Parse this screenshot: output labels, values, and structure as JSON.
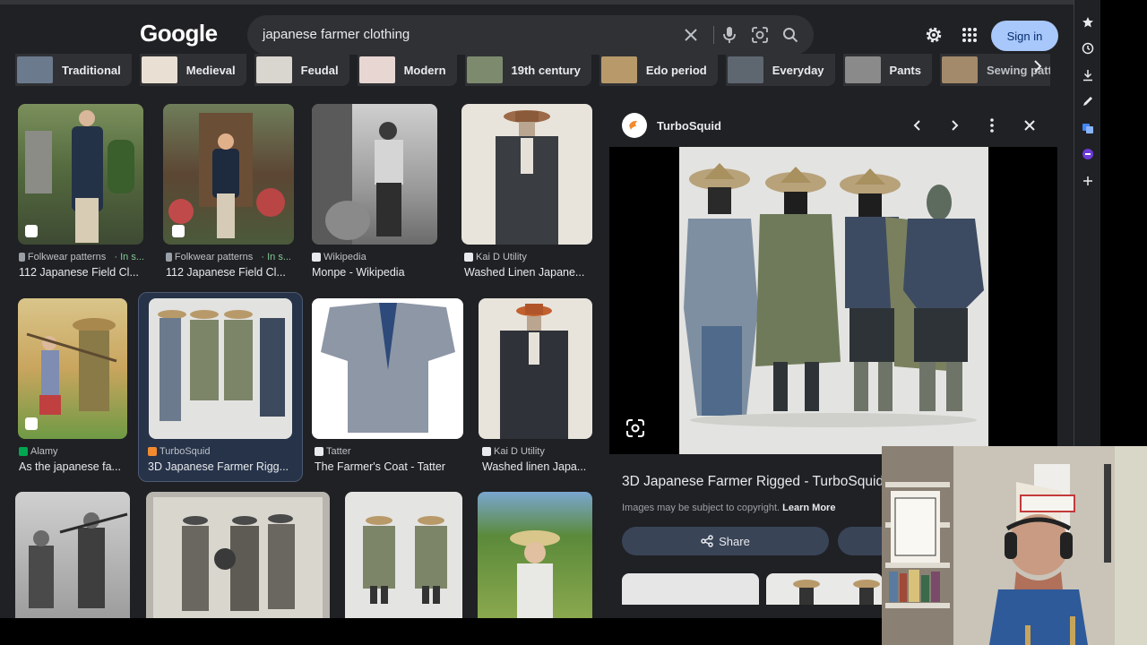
{
  "search": {
    "logo": "Google",
    "query": "japanese farmer clothing",
    "signin_label": "Sign in"
  },
  "chips": [
    {
      "label": "Traditional",
      "color": "#6b7a8c"
    },
    {
      "label": "Medieval",
      "color": "#c9b49a"
    },
    {
      "label": "Feudal",
      "color": "#a8a29b"
    },
    {
      "label": "Modern",
      "color": "#b14a3e"
    },
    {
      "label": "19th century",
      "color": "#7d8a6e"
    },
    {
      "label": "Edo period",
      "color": "#b89a6a"
    },
    {
      "label": "Everyday",
      "color": "#5e6670"
    },
    {
      "label": "Pants",
      "color": "#8a8a8a"
    },
    {
      "label": "Sewing patte",
      "color": "#a38a6a"
    }
  ],
  "results": [
    {
      "source": "Folkwear patterns",
      "source_extra": "· In s...",
      "title": "112 Japanese Field Cl...",
      "fav_color": "#9aa0a6"
    },
    {
      "source": "Folkwear patterns",
      "source_extra": "· In s...",
      "title": "112 Japanese Field Cl...",
      "fav_color": "#9aa0a6"
    },
    {
      "source": "Wikipedia",
      "source_extra": "",
      "title": "Monpe - Wikipedia",
      "fav_color": "#e8eaed"
    },
    {
      "source": "Kai D Utility",
      "source_extra": "",
      "title": "Washed Linen Japane...",
      "fav_color": "#e8eaed"
    },
    {
      "source": "Alamy",
      "source_extra": "",
      "title": "As the japanese fa...",
      "fav_color": "#00a651"
    },
    {
      "source": "TurboSquid",
      "source_extra": "",
      "title": "3D Japanese Farmer Rigg...",
      "fav_color": "#f28b30"
    },
    {
      "source": "Tatter",
      "source_extra": "",
      "title": "The Farmer's Coat - Tatter",
      "fav_color": "#e8eaed"
    },
    {
      "source": "Kai D Utility",
      "source_extra": "",
      "title": "Washed linen Japa...",
      "fav_color": "#e8eaed"
    }
  ],
  "panel": {
    "site": "TurboSquid",
    "title": "3D Japanese Farmer Rigged - TurboSquid",
    "copyright": "Images may be subject to copyright.",
    "learn_more": "Learn More",
    "share_label": "Share"
  },
  "colors": {
    "accent": "#a8c7fa",
    "background": "#202124",
    "surface": "#303134"
  }
}
